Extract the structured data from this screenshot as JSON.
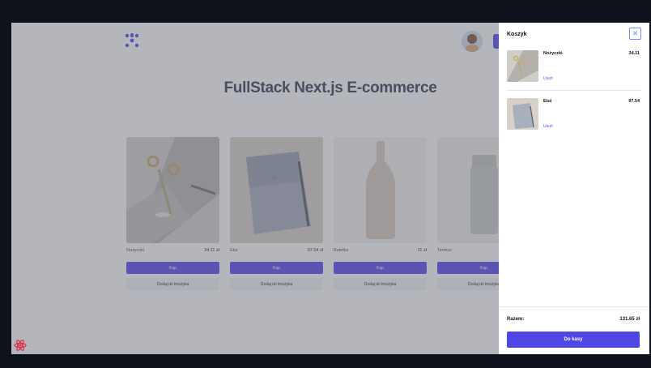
{
  "page": {
    "title": "FullStack Next.js E-commerce",
    "products": [
      {
        "name": "Nożyczki",
        "price": "34.11 zł",
        "buy_label": "Kup",
        "add_label": "Dodaj do koszyka"
      },
      {
        "name": "Etui",
        "price": "97.54 zł",
        "buy_label": "Kup",
        "add_label": "Dodaj do koszyka"
      },
      {
        "name": "Butelka",
        "price": "11 zł",
        "buy_label": "Kup",
        "add_label": "Dodaj do koszyka"
      },
      {
        "name": "Termos",
        "price": "",
        "buy_label": "Kup",
        "add_label": "Dodaj do koszyka"
      }
    ]
  },
  "cart": {
    "title": "Koszyk",
    "close_icon": "close-icon",
    "items": [
      {
        "name": "Nożyczki",
        "price": "34.11",
        "remove_label": "Usuń"
      },
      {
        "name": "Etui",
        "price": "97.54",
        "remove_label": "Usuń"
      }
    ],
    "total_label": "Razem:",
    "total_value": "131.65 zł",
    "checkout_label": "Do kasy"
  },
  "colors": {
    "accent": "#4f46e5",
    "overlay": "#5a5e6a",
    "background": "#0e121a"
  }
}
